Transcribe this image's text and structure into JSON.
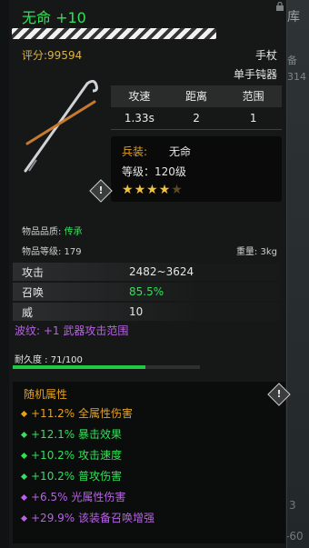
{
  "background": {
    "library_label": "库",
    "frag_a": "备",
    "frag_b": "314",
    "frag_c": "3",
    "frag_d": "-60"
  },
  "item": {
    "name_line": "无命 +10",
    "score": "评分:99594",
    "type_line1": "手杖",
    "type_line2": "单手钝器",
    "stats_headers": [
      "攻速",
      "距离",
      "范围"
    ],
    "stats_values": [
      "1.33s",
      "2",
      "1"
    ],
    "weapon_label": "兵装:",
    "weapon_value": "无命",
    "level": "等级：120级",
    "stars_filled": 4,
    "stars_total": 5,
    "info_icon": "!",
    "quality_label": "物品品质:",
    "quality_value": "传承",
    "item_level": "物品等级: 179",
    "weight": "重量: 3kg",
    "attributes": [
      {
        "k": "攻击",
        "v": "2482~3624"
      },
      {
        "k": "召唤",
        "v": "85.5%"
      },
      {
        "k": "威",
        "v": "10"
      }
    ],
    "wave": "波纹: +1 武器攻击范围",
    "durability_text": "耐久度 : 71/100",
    "durability_fraction": 0.71,
    "random_title": "随机属性",
    "random_attrs": [
      {
        "text": "+11.2% 全属性伤害",
        "color": "gold"
      },
      {
        "text": "+12.1% 暴击效果",
        "color": "green"
      },
      {
        "text": "+10.2% 攻击速度",
        "color": "green"
      },
      {
        "text": "+10.2% 普攻伤害",
        "color": "green"
      },
      {
        "text": "+6.5% 光属性伤害",
        "color": "purple"
      },
      {
        "text": "+29.9% 该装备召唤增强",
        "color": "purple"
      }
    ]
  },
  "colors": {
    "green": "#32e05a",
    "gold": "#e4a21e",
    "purple": "#b862e6"
  }
}
